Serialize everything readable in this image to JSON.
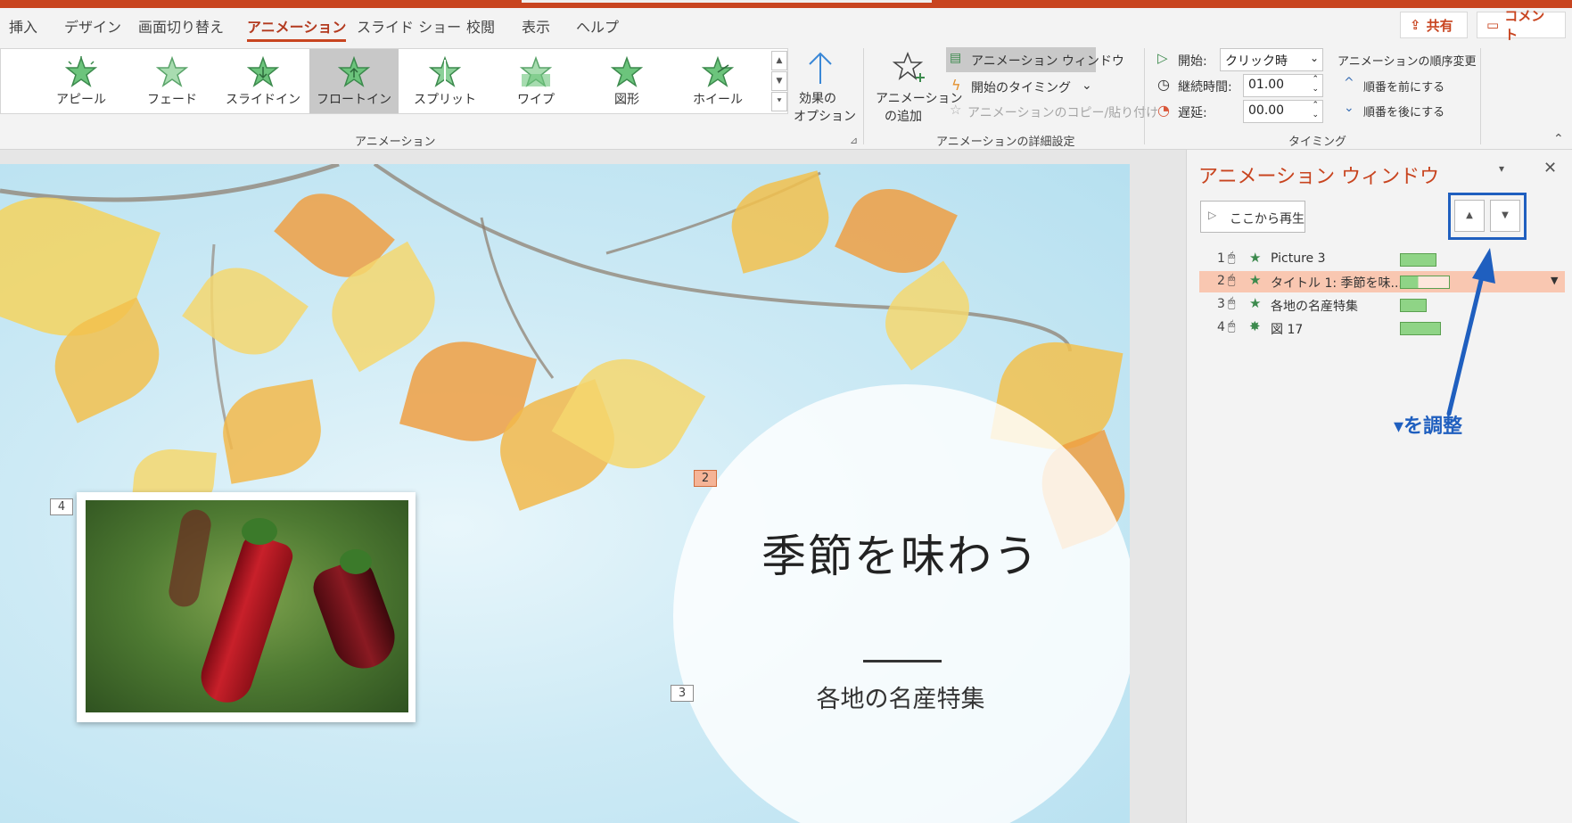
{
  "tabs": [
    "挿入",
    "デザイン",
    "画面切り替え",
    "アニメーション",
    "スライド ショー",
    "校閲",
    "表示",
    "ヘルプ"
  ],
  "active_tab": "アニメーション",
  "share_label": "共有",
  "comment_label": "コメント",
  "gallery": {
    "effects": [
      "アピール",
      "フェード",
      "スライドイン",
      "フロートイン",
      "スプリット",
      "ワイプ",
      "図形",
      "ホイール"
    ],
    "selected": "フロートイン"
  },
  "effect_options_label1": "効果の",
  "effect_options_label2": "オプション",
  "animation_group_label": "アニメーション",
  "add_animation_label1": "アニメーション",
  "add_animation_label2": "の追加",
  "animation_pane_button": "アニメーション ウィンドウ",
  "trigger_label": "開始のタイミング",
  "painter_label": "アニメーションのコピー/貼り付け",
  "advanced_group_label": "アニメーションの詳細設定",
  "timing": {
    "start_label": "開始:",
    "start_value": "クリック時",
    "duration_label": "継続時間:",
    "duration_value": "01.00",
    "delay_label": "遅延:",
    "delay_value": "00.00",
    "reorder_label": "アニメーションの順序変更",
    "move_earlier": "順番を前にする",
    "move_later": "順番を後にする",
    "group_label": "タイミング"
  },
  "slide": {
    "title": "季節を味わう",
    "subtitle": "各地の名産特集",
    "tags": [
      "2",
      "3",
      "4"
    ]
  },
  "pane": {
    "title": "アニメーション ウィンドウ",
    "play_label": "ここから再生",
    "items": [
      {
        "num": "1",
        "name": "Picture 3"
      },
      {
        "num": "2",
        "name": "タイトル 1: 季節を味..."
      },
      {
        "num": "3",
        "name": "各地の名産特集"
      },
      {
        "num": "4",
        "name": "図 17"
      }
    ],
    "annotation": "▾を調整"
  },
  "colors": {
    "accent": "#c8441f",
    "annotation_blue": "#1f5fbf",
    "timeline_green": "#8fd486"
  }
}
